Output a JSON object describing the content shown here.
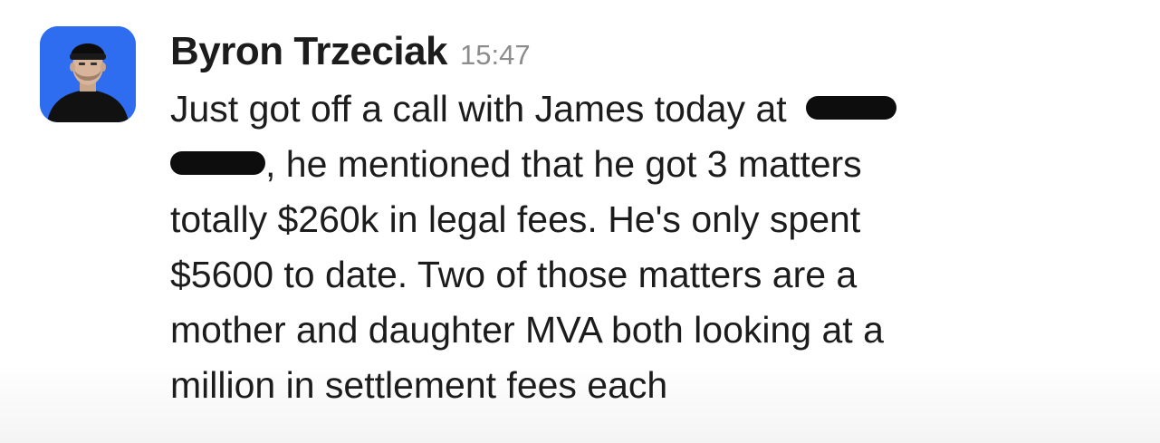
{
  "message": {
    "author": "Byron Trzeciak",
    "timestamp": "15:47",
    "avatar_icon": "profile-photo",
    "lines": {
      "l1": "Just got off a call with James today at ",
      "l2": ", he mentioned that he got 3 matters",
      "l3": "totally $260k in legal fees. He's only spent",
      "l4": "$5600 to date. Two of those matters are a",
      "l5": "mother and daughter MVA both looking at a",
      "l6": "million in settlement fees each"
    }
  },
  "colors": {
    "avatar_bg": "#2f6df0",
    "text": "#1d1c1d",
    "timestamp": "#8c8c8c",
    "redaction": "#0d0d0d"
  }
}
